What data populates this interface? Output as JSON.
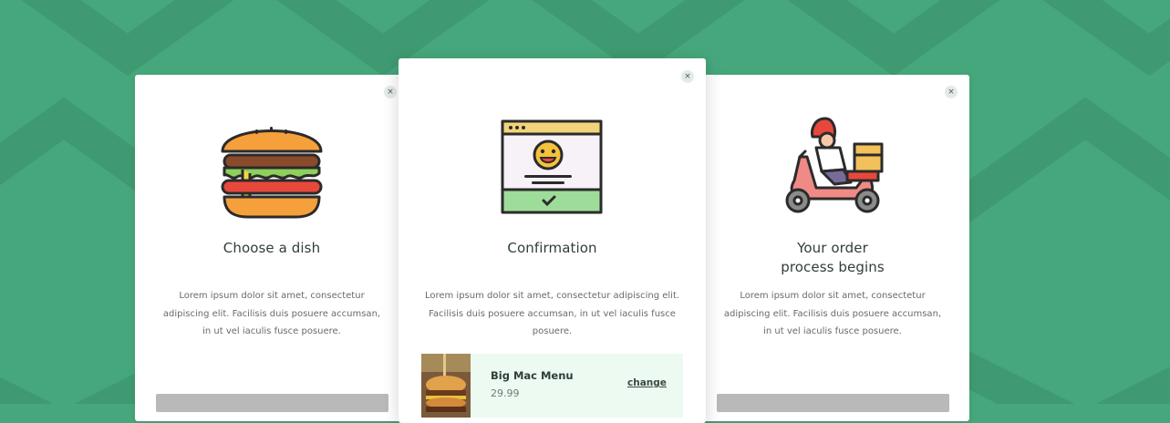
{
  "colors": {
    "background": "#46a77d",
    "card": "#ffffff",
    "accent_light": "#ecfaf2"
  },
  "steps": [
    {
      "icon": "burger-icon",
      "title": "Choose a dish",
      "description": "Lorem ipsum dolor sit amet, consectetur adipiscing elit. Facilisis duis posuere accumsan, in ut vel iaculis fusce posuere.",
      "close_label": "×"
    },
    {
      "icon": "browser-smiley-icon",
      "title": "Confirmation",
      "description": "Lorem ipsum dolor sit amet, consectetur adipiscing elit. Facilisis duis posuere accumsan, in ut vel iaculis fusce posuere.",
      "close_label": "×"
    },
    {
      "icon": "delivery-scooter-icon",
      "title_line1": "Your order",
      "title_line2": "process begins",
      "description": "Lorem ipsum dolor sit amet, consectetur adipiscing elit. Facilisis duis posuere accumsan, in ut vel iaculis fusce posuere.",
      "close_label": "×"
    }
  ],
  "order": {
    "item_name": "Big Mac Menu",
    "price": "29.99",
    "change_label": "change"
  }
}
